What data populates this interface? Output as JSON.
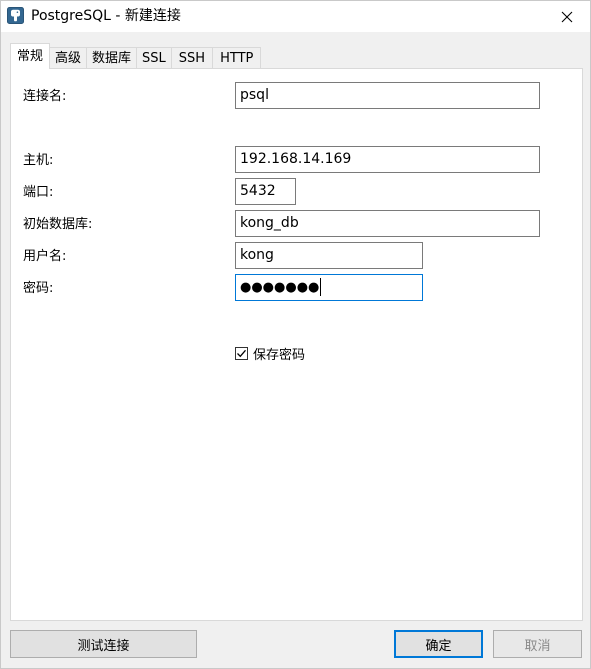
{
  "window": {
    "title": "PostgreSQL - 新建连接"
  },
  "tabs": [
    {
      "label": "常规",
      "active": true
    },
    {
      "label": "高级",
      "active": false
    },
    {
      "label": "数据库",
      "active": false
    },
    {
      "label": "SSL",
      "active": false
    },
    {
      "label": "SSH",
      "active": false
    },
    {
      "label": "HTTP",
      "active": false
    }
  ],
  "form": {
    "connection_name": {
      "label": "连接名:",
      "value": "psql"
    },
    "host": {
      "label": "主机:",
      "value": "192.168.14.169"
    },
    "port": {
      "label": "端口:",
      "value": "5432"
    },
    "initial_database": {
      "label": "初始数据库:",
      "value": "kong_db"
    },
    "username": {
      "label": "用户名:",
      "value": "kong"
    },
    "password": {
      "label": "密码:",
      "masked_value": "●●●●●●●"
    },
    "save_password": {
      "label": "保存密码",
      "checked": true
    }
  },
  "buttons": {
    "test_connection": "测试连接",
    "ok": "确定",
    "cancel": "取消"
  },
  "colors": {
    "accent": "#0078d7",
    "panel_bg": "#ffffff",
    "dialog_bg": "#f0f0f0"
  },
  "icons": {
    "app": "postgresql-elephant-icon",
    "close": "close-icon",
    "checkbox": "checkmark-icon"
  }
}
